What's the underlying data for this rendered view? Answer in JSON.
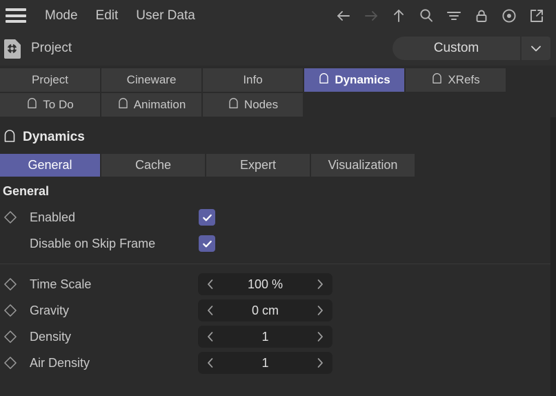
{
  "menubar": {
    "hamburger_icon": "hamburger-icon",
    "items": [
      {
        "label": "Mode"
      },
      {
        "label": "Edit"
      },
      {
        "label": "User Data"
      }
    ],
    "tools": [
      {
        "name": "arrow-left-icon",
        "enabled": true
      },
      {
        "name": "arrow-right-icon",
        "enabled": false
      },
      {
        "name": "arrow-up-icon",
        "enabled": true
      },
      {
        "name": "search-icon",
        "enabled": true
      },
      {
        "name": "filter-icon",
        "enabled": true
      },
      {
        "name": "lock-icon",
        "enabled": true
      },
      {
        "name": "record-icon",
        "enabled": true
      },
      {
        "name": "open-external-icon",
        "enabled": true
      }
    ]
  },
  "object_row": {
    "icon": "project-gear-icon",
    "title": "Project",
    "dropdown": {
      "value": "Custom",
      "arrow_icon": "chevron-down-icon"
    }
  },
  "tabs_row1": [
    {
      "label": "Project",
      "icon": null,
      "active": false,
      "key": "t-project"
    },
    {
      "label": "Cineware",
      "icon": null,
      "active": false,
      "key": "t-cineware"
    },
    {
      "label": "Info",
      "icon": null,
      "active": false,
      "key": "t-info"
    },
    {
      "label": "Dynamics",
      "icon": "arch-icon",
      "active": true,
      "key": "t-dynamics"
    },
    {
      "label": "XRefs",
      "icon": "arch-icon",
      "active": false,
      "key": "t-xrefs"
    }
  ],
  "tabs_row2": [
    {
      "label": "To Do",
      "icon": "arch-icon",
      "active": false,
      "key": "t-todo"
    },
    {
      "label": "Animation",
      "icon": "arch-icon",
      "active": false,
      "key": "t-animation"
    },
    {
      "label": "Nodes",
      "icon": "arch-icon",
      "active": false,
      "key": "t-nodes"
    }
  ],
  "object_header": {
    "icon": "arch-icon",
    "label": "Dynamics"
  },
  "subtabs": [
    {
      "label": "General",
      "active": true,
      "key": "st-general"
    },
    {
      "label": "Cache",
      "active": false,
      "key": "st-cache"
    },
    {
      "label": "Expert",
      "active": false,
      "key": "st-expert"
    },
    {
      "label": "Visualization",
      "active": false,
      "key": "st-visualization"
    }
  ],
  "general_group": {
    "title": "General",
    "checkboxes": [
      {
        "label": "Enabled",
        "checked": true,
        "has_keyframe": true
      },
      {
        "label": "Disable on Skip Frame",
        "checked": true,
        "has_keyframe": false
      }
    ],
    "numbers": [
      {
        "label": "Time Scale",
        "value": "100 %",
        "has_keyframe": true
      },
      {
        "label": "Gravity",
        "value": "0 cm",
        "has_keyframe": true
      },
      {
        "label": "Density",
        "value": "1",
        "has_keyframe": true
      },
      {
        "label": "Air Density",
        "value": "1",
        "has_keyframe": true
      }
    ],
    "stepper_left_icon": "chevron-left-icon",
    "stepper_right_icon": "chevron-right-icon",
    "keyframe_icon": "keyframe-diamond-icon",
    "check_icon": "checkmark-icon"
  },
  "colors": {
    "accent": "#5c5fa3",
    "background": "#2b2b2b",
    "panel": "#2f2f2f",
    "tab": "#3a3a3a",
    "field": "#222222",
    "text": "#c9c9c9"
  }
}
